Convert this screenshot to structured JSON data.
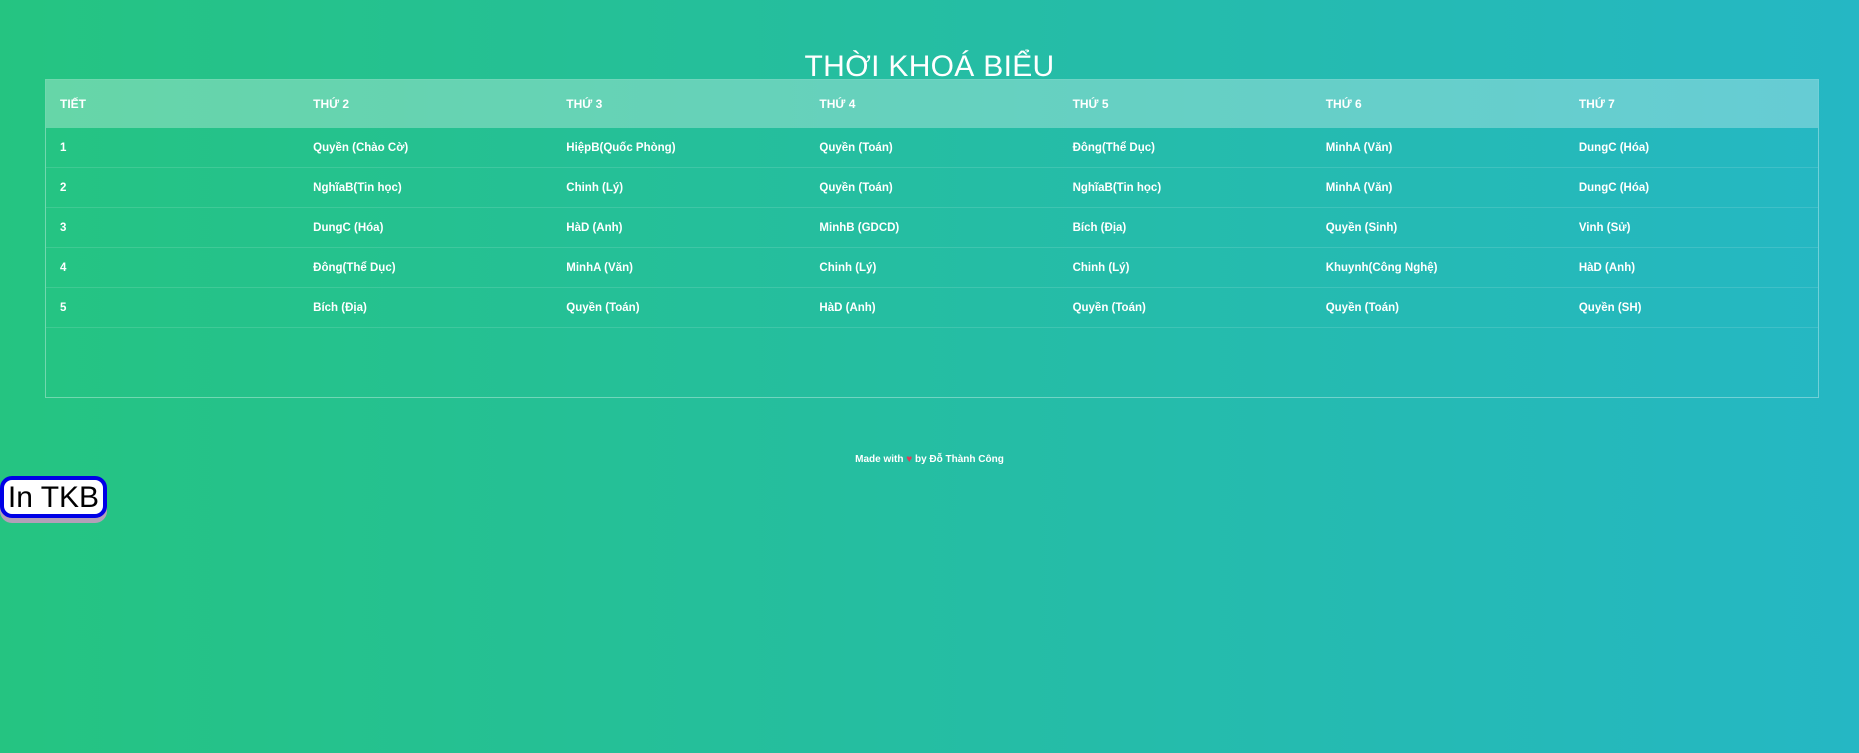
{
  "page": {
    "title": "THỜI KHOÁ BIỂU"
  },
  "table": {
    "headers": [
      "TIẾT",
      "THỨ 2",
      "THỨ 3",
      "THỨ 4",
      "THỨ 5",
      "THỨ 6",
      "THỨ 7"
    ],
    "rows": [
      [
        "1",
        "Quyền (Chào Cờ)",
        "HiệpB(Quốc Phòng)",
        "Quyền (Toán)",
        "Đông(Thể Dục)",
        "MinhA (Văn)",
        "DungC (Hóa)"
      ],
      [
        "2",
        "NghĩaB(Tin học)",
        "Chinh (Lý)",
        "Quyền (Toán)",
        "NghĩaB(Tin học)",
        "MinhA (Văn)",
        "DungC (Hóa)"
      ],
      [
        "3",
        "DungC (Hóa)",
        "HàD (Anh)",
        "MinhB (GDCD)",
        "Bích (Địa)",
        "Quyền (Sinh)",
        "Vinh (Sử)"
      ],
      [
        "4",
        "Đông(Thể Dục)",
        "MinhA (Văn)",
        "Chinh (Lý)",
        "Chinh (Lý)",
        "Khuynh(Công Nghệ)",
        "HàD (Anh)"
      ],
      [
        "5",
        "Bích (Địa)",
        "Quyền (Toán)",
        "HàD (Anh)",
        "Quyền (Toán)",
        "Quyền (Toán)",
        "Quyền (SH)"
      ]
    ]
  },
  "footer": {
    "made_with": "Made with",
    "heart": "♥",
    "by": "by Đỗ Thành Công"
  },
  "print_button": {
    "label": "In TKB"
  },
  "colors": {
    "gradient_start": "#25c481",
    "gradient_end": "#25b7c4",
    "button_border": "#0000e6",
    "heart": "#e2385a"
  }
}
